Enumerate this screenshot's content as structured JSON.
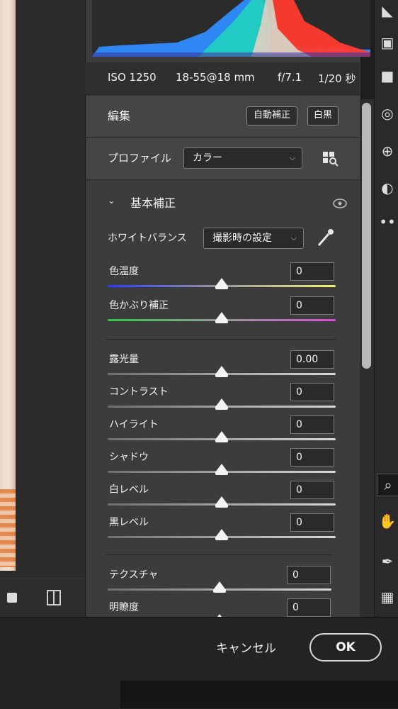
{
  "meta": {
    "iso": "ISO 1250",
    "lens": "18-55@18 mm",
    "aperture": "f/7.1",
    "shutter": "1/20 秒"
  },
  "edit": {
    "title": "編集",
    "auto_label": "自動補正",
    "bw_label": "白黒"
  },
  "profile": {
    "label": "プロファイル",
    "value": "カラー"
  },
  "basic": {
    "title": "基本補正",
    "white_balance_label": "ホワイトバランス",
    "white_balance_value": "撮影時の設定",
    "sliders": [
      {
        "label": "色温度",
        "value": "0",
        "level": 0.5
      },
      {
        "label": "色かぶり補正",
        "value": "0",
        "level": 0.5
      },
      {
        "label": "露光量",
        "value": "0.00",
        "level": 0.5
      },
      {
        "label": "コントラスト",
        "value": "0",
        "level": 0.5
      },
      {
        "label": "ハイライト",
        "value": "0",
        "level": 0.5
      },
      {
        "label": "シャドウ",
        "value": "0",
        "level": 0.5
      },
      {
        "label": "白レベル",
        "value": "0",
        "level": 0.5
      },
      {
        "label": "黒レベル",
        "value": "0",
        "level": 0.5
      }
    ],
    "presence": [
      {
        "label": "テクスチャ",
        "value": "0",
        "level": 0.5
      },
      {
        "label": "明瞭度",
        "value": "0",
        "level": 0.5
      }
    ]
  },
  "footer": {
    "cancel_label": "キャンセル",
    "ok_label": "OK"
  },
  "colors": {
    "panel_bg": "#3c3c3c",
    "temperature_gradient": [
      "#2a3cff",
      "#f3f07a"
    ],
    "tint_gradient": [
      "#34c74a",
      "#d84ed8"
    ]
  },
  "icons": [
    "view-square-icon",
    "split-view-icon",
    "crop-icon",
    "heal-icon",
    "mask-icon",
    "redeye-icon",
    "more-icon",
    "zoom-icon",
    "hand-icon",
    "eyedropper-icon",
    "grid-icon",
    "eye-icon",
    "chevron-down-icon",
    "profile-browser-icon"
  ]
}
